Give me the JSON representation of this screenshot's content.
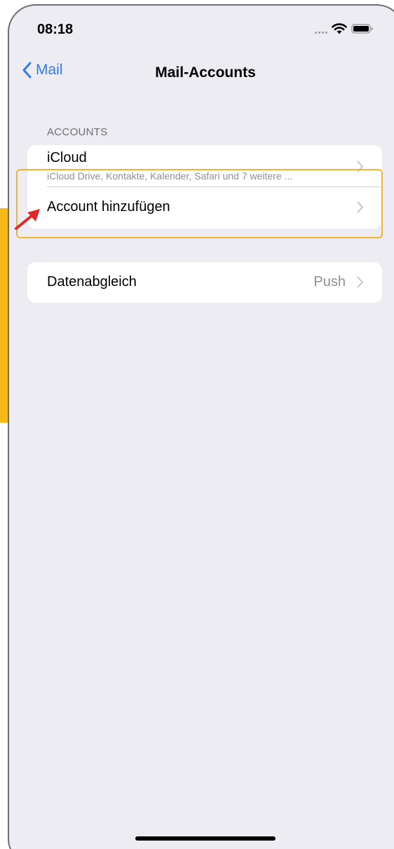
{
  "status_bar": {
    "time": "08:18",
    "icons": [
      "signal-dots-icon",
      "wifi-icon",
      "battery-icon"
    ]
  },
  "nav": {
    "back_label": "Mail",
    "title": "Mail-Accounts"
  },
  "accounts_section": {
    "header": "ACCOUNTS",
    "items": [
      {
        "title": "iCloud",
        "subtitle": "iCloud Drive, Kontakte, Kalender, Safari und 7 weitere ..."
      },
      {
        "title": "Account hinzufügen"
      }
    ]
  },
  "sync_section": {
    "title": "Datenabgleich",
    "value": "Push"
  },
  "colors": {
    "accent": "#2f7bf6",
    "background": "#ececf2",
    "highlight": "#f3b52d",
    "arrow": "#e3262b",
    "side_bar": "#f6b91a"
  }
}
